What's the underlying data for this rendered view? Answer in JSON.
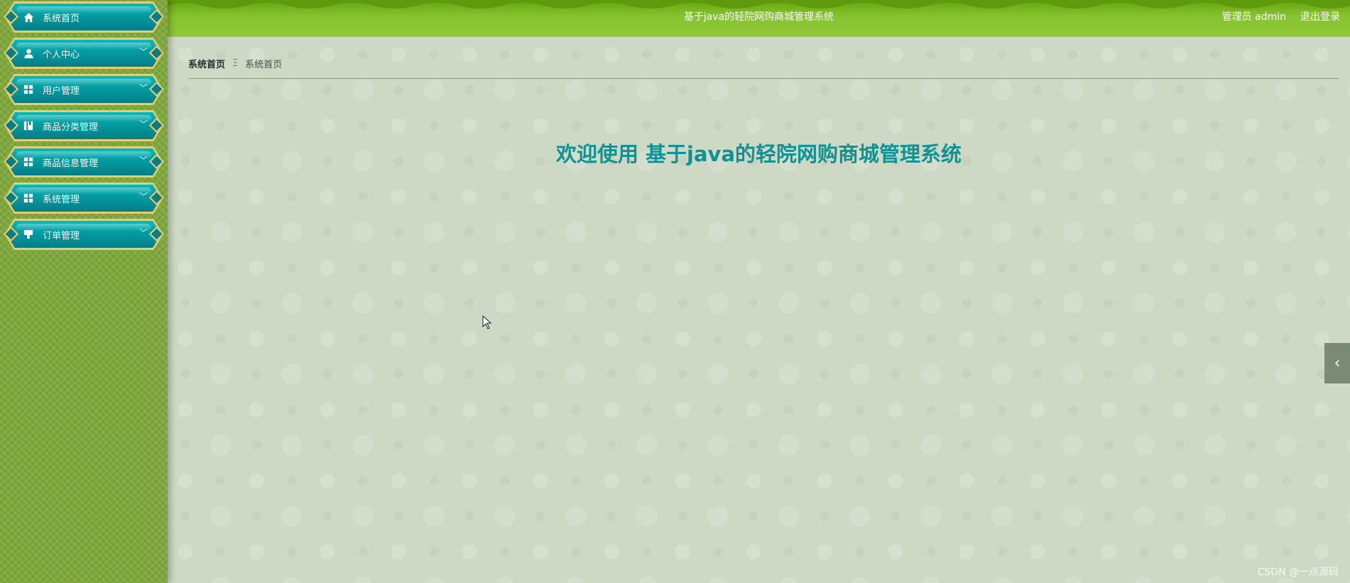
{
  "app": {
    "title": "基于java的轻院网购商城管理系统"
  },
  "header": {
    "user_label": "管理员 admin",
    "logout_label": "退出登录"
  },
  "sidebar": {
    "items": [
      {
        "label": "系统首页",
        "icon": "home-icon"
      },
      {
        "label": "个人中心",
        "icon": "person-icon"
      },
      {
        "label": "用户管理",
        "icon": "grid-icon"
      },
      {
        "label": "商品分类管理",
        "icon": "book-icon"
      },
      {
        "label": "商品信息管理",
        "icon": "grid-icon"
      },
      {
        "label": "系统管理",
        "icon": "grid-icon"
      },
      {
        "label": "订单管理",
        "icon": "form-icon"
      }
    ]
  },
  "breadcrumb": {
    "root": "系统首页",
    "separator": "Ξ",
    "current": "系统首页"
  },
  "main": {
    "welcome": "欢迎使用 基于java的轻院网购商城管理系统"
  },
  "watermark": "CSDN @一点源码",
  "colors": {
    "header_green": "#86c430",
    "sidebar_green": "#7fa73b",
    "menu_teal": "#03a1a6",
    "menu_gold": "#e2cf79",
    "welcome_teal": "#0f9296",
    "content_bg": "#cdd9c4"
  }
}
